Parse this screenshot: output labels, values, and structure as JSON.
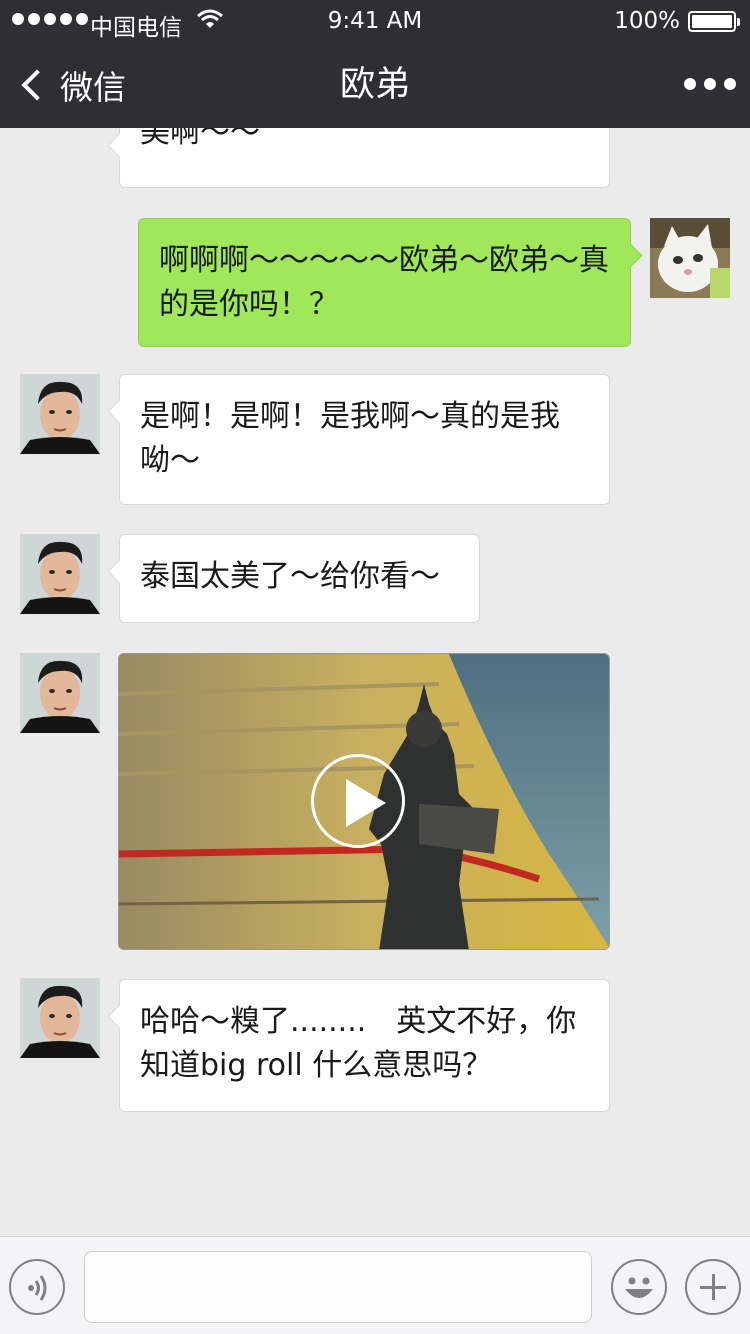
{
  "status_bar": {
    "carrier": "中国电信",
    "time": "9:41 AM",
    "battery": "100%"
  },
  "nav": {
    "back_label": "微信",
    "title": "欧弟"
  },
  "messages": [
    {
      "side": "left",
      "text": "美啊～～"
    },
    {
      "side": "right",
      "text": "啊啊啊～～～～～欧弟～欧弟～真的是你吗！？"
    },
    {
      "side": "left",
      "text": "是啊！是啊！是我啊～真的是我呦～"
    },
    {
      "side": "left",
      "text": "泰国太美了～给你看～"
    },
    {
      "side": "left",
      "type": "video"
    },
    {
      "side": "left",
      "text": "哈哈～糗了........　英文不好，你知道big roll 什么意思吗？"
    }
  ],
  "input": {
    "placeholder": ""
  },
  "icons": {
    "back": "chevron-left-icon",
    "more": "more-dots-icon",
    "voice": "voice-icon",
    "emoji": "emoji-icon",
    "plus": "plus-icon",
    "play": "play-icon"
  }
}
